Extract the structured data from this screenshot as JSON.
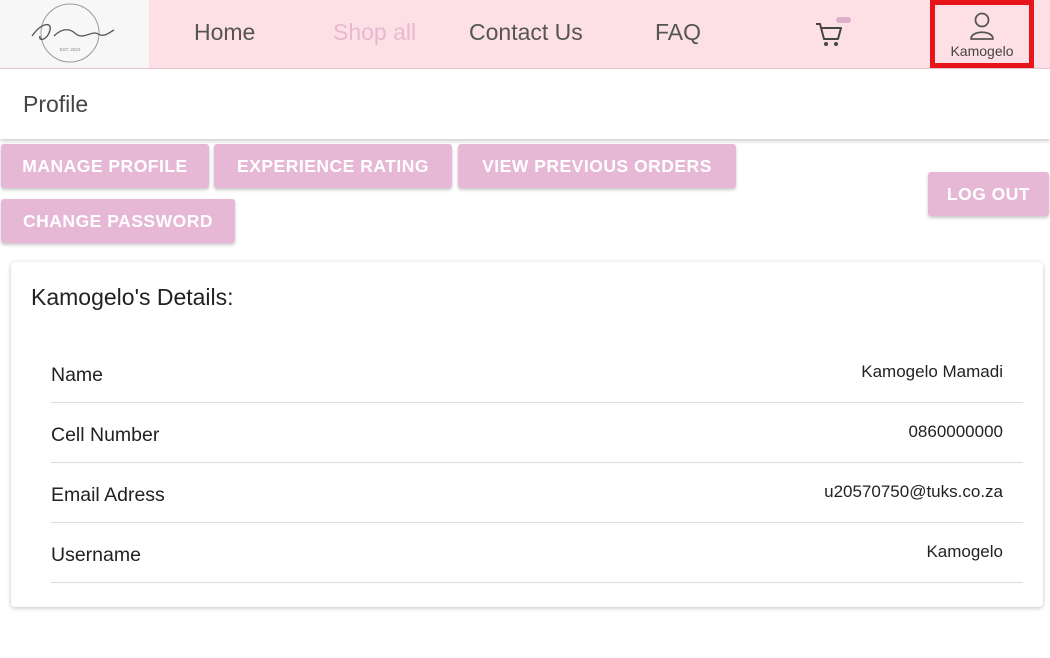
{
  "nav": {
    "logo_text": "Its Personal",
    "links": [
      {
        "label": "Home"
      },
      {
        "label": "Shop all"
      },
      {
        "label": "Contact Us"
      },
      {
        "label": "FAQ"
      }
    ],
    "user_name": "Kamogelo",
    "active_color": "#e8b8cf",
    "nav_bg": "#fde0e6"
  },
  "profile": {
    "title": "Profile"
  },
  "buttons": {
    "manage_profile": "MANAGE PROFILE",
    "experience_rating": "EXPERIENCE RATING",
    "view_previous_orders": "VIEW PREVIOUS ORDERS",
    "change_password": "CHANGE PASSWORD",
    "log_out": "LOG OUT",
    "color": "#e6b8d6"
  },
  "details": {
    "title": "Kamogelo's Details:",
    "rows": [
      {
        "label": "Name",
        "value": "Kamogelo Mamadi"
      },
      {
        "label": "Cell Number",
        "value": "0860000000"
      },
      {
        "label": "Email Adress",
        "value": "u20570750@tuks.co.za"
      },
      {
        "label": "Username",
        "value": "Kamogelo"
      }
    ]
  }
}
